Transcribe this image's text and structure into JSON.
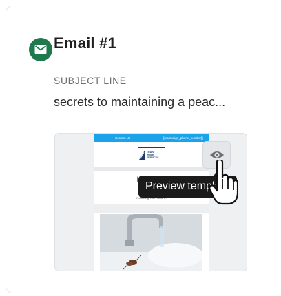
{
  "card": {
    "icon": "envelope-icon",
    "title": "Email #1",
    "subject_label": "SUBJECT LINE",
    "subject_value": "secrets to maintaining a peac..."
  },
  "preview": {
    "topbar_left": "Contact Us",
    "topbar_right": "{{campaign_phone_number}}",
    "logo_text_1": "TITAN",
    "logo_text_2": "HOME SERVICES",
    "headline_line1": "Latest N",
    "headline_line2": "Hon",
    "small_text": "Protecting Your Home Fr",
    "button_icon": "eye-icon",
    "tooltip_text": "Preview template",
    "cursor_icon": "hand-pointer-icon"
  },
  "colors": {
    "brand_green": "#1e7a4c",
    "preview_blue": "#1aa3e8",
    "tooltip_bg": "#1b1b1b"
  }
}
